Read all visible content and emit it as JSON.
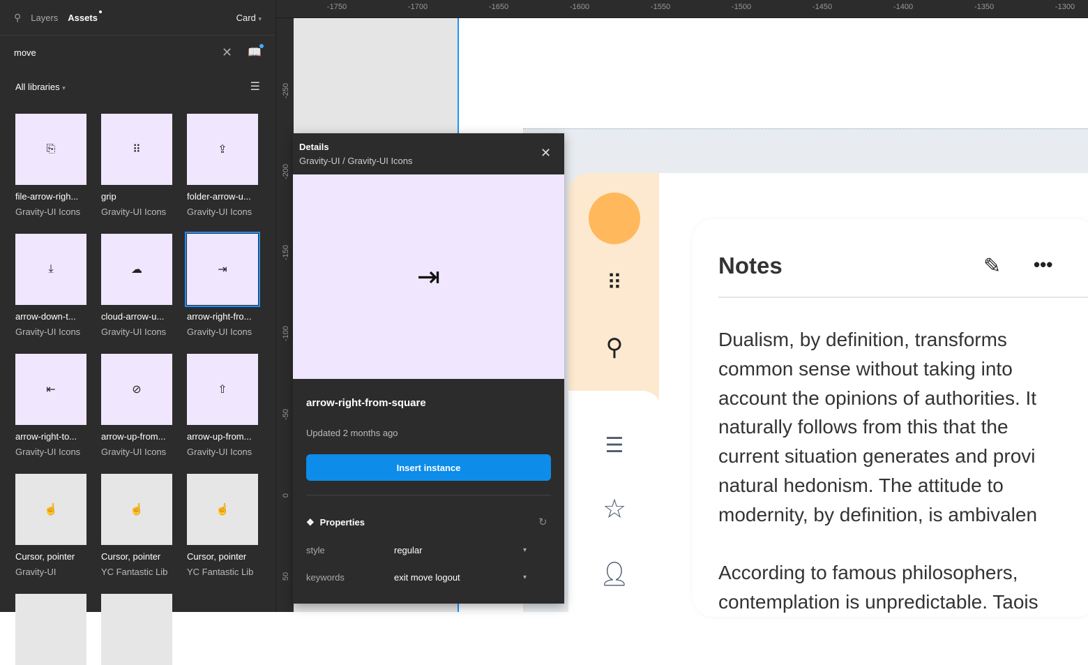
{
  "left_panel": {
    "tabs": [
      {
        "label": "Layers"
      },
      {
        "label": "Assets"
      }
    ],
    "page_selector": "Card",
    "search": {
      "value": "move"
    },
    "library_filter": "All libraries",
    "assets": [
      {
        "name": "file-arrow-righ...",
        "library": "Gravity-UI Icons",
        "glyph": "⎘",
        "icon": "file-arrow-right-icon"
      },
      {
        "name": "grip",
        "library": "Gravity-UI Icons",
        "glyph": "⠿",
        "icon": "grip-icon"
      },
      {
        "name": "folder-arrow-u...",
        "library": "Gravity-UI Icons",
        "glyph": "⇪",
        "icon": "folder-arrow-up-icon"
      },
      {
        "name": "arrow-down-t...",
        "library": "Gravity-UI Icons",
        "glyph": "⤓",
        "icon": "arrow-down-to-square-icon"
      },
      {
        "name": "cloud-arrow-u...",
        "library": "Gravity-UI Icons",
        "glyph": "☁",
        "icon": "cloud-arrow-up-icon"
      },
      {
        "name": "arrow-right-fro...",
        "library": "Gravity-UI Icons",
        "glyph": "⇥",
        "icon": "arrow-right-from-square-icon",
        "selected": true
      },
      {
        "name": "arrow-right-to...",
        "library": "Gravity-UI Icons",
        "glyph": "⇤",
        "icon": "arrow-right-to-square-icon"
      },
      {
        "name": "arrow-up-from...",
        "library": "Gravity-UI Icons",
        "glyph": "⊘",
        "icon": "arrow-up-from-line-slash-icon"
      },
      {
        "name": "arrow-up-from...",
        "library": "Gravity-UI Icons",
        "glyph": "⇧",
        "icon": "arrow-up-from-square-icon"
      },
      {
        "name": "Cursor, pointer",
        "library": "Gravity-UI",
        "glyph": "☝",
        "icon": "cursor-pointer-icon",
        "gray": true
      },
      {
        "name": "Cursor, pointer",
        "library": "YC Fantastic Lib",
        "glyph": "☝",
        "icon": "cursor-pointer-icon",
        "gray": true
      },
      {
        "name": "Cursor, pointer",
        "library": "YC Fantastic Lib",
        "glyph": "☝",
        "icon": "cursor-pointer-icon",
        "gray": true
      },
      {
        "name": "",
        "library": "",
        "glyph": "",
        "icon": "",
        "gray": true
      },
      {
        "name": "",
        "library": "",
        "glyph": "",
        "icon": "",
        "gray": true
      }
    ]
  },
  "rulers": {
    "top": [
      "-1750",
      "-1700",
      "-1650",
      "-1600",
      "-1550",
      "-1500",
      "-1450",
      "-1400",
      "-1350",
      "-1300"
    ],
    "left": [
      "-250",
      "-200",
      "-150",
      "-100",
      "-50",
      "0",
      "50"
    ]
  },
  "details": {
    "title": "Details",
    "path": "Gravity-UI / Gravity-UI Icons",
    "component_name": "arrow-right-from-square",
    "updated": "Updated 2 months ago",
    "insert_label": "Insert instance",
    "properties_label": "Properties",
    "properties": [
      {
        "key": "style",
        "value": "regular"
      },
      {
        "key": "keywords",
        "value": "exit move logout"
      }
    ]
  },
  "canvas": {
    "notes_title": "Notes",
    "paragraph1": [
      "Dualism, by definition, transforms",
      "common sense without taking into",
      "account the opinions of authorities. It",
      "naturally follows from this that the",
      "current situation generates and provi",
      "natural hedonism. The attitude to",
      "modernity, by definition, is ambivalen"
    ],
    "paragraph2": [
      "According to famous philosophers,",
      "contemplation is unpredictable. Taois"
    ],
    "colors": {
      "accent": "#0d8ce9",
      "avatar": "#ffb85c",
      "sidebar": "#fde9cf",
      "tile": "#f0e6fe"
    }
  }
}
